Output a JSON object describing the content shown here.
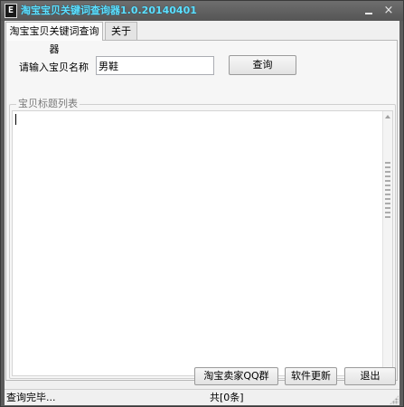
{
  "window": {
    "title": "淘宝宝贝关键词查询器1.0.20140401",
    "app_icon": "app-logo-icon",
    "minimize_symbol": "minimize-icon",
    "close_symbol": "×"
  },
  "tabs": [
    {
      "label": "淘宝宝贝关键词查询器",
      "active": true
    },
    {
      "label": "关于",
      "active": false
    }
  ],
  "search": {
    "label": "请输入宝贝名称",
    "value": "男鞋",
    "button": "查询"
  },
  "results": {
    "group_title": "宝贝标题列表",
    "text": ""
  },
  "buttons": {
    "qq_group": "淘宝卖家QQ群",
    "update": "软件更新",
    "exit": "退出"
  },
  "status": {
    "message": "查询完毕...",
    "count": "共[0条]"
  },
  "colors": {
    "title_text": "#5de0ff",
    "title_bar": "#5c5c5c",
    "client_bg": "#f0f0f0"
  }
}
